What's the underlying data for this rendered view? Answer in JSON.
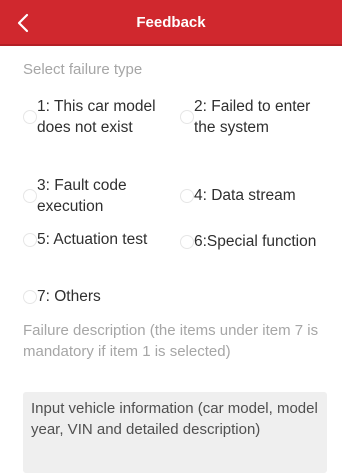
{
  "header": {
    "title": "Feedback"
  },
  "section": {
    "select_label": "Select failure type"
  },
  "options": [
    {
      "label": "1: This car model does not exist"
    },
    {
      "label": "2: Failed to enter the system"
    },
    {
      "label": "3: Fault code execution"
    },
    {
      "label": "4: Data stream"
    },
    {
      "label": "5: Actuation test"
    },
    {
      "label": "6:Special function"
    },
    {
      "label": "7: Others"
    }
  ],
  "description": {
    "label": "Failure description (the items under item 7 is mandatory if item 1 is selected)",
    "placeholder": "Input vehicle information (car model, model year, VIN and detailed description)"
  },
  "colors": {
    "header_bg": "#d0282e",
    "hint_text": "#a6a6a6",
    "body_text": "#2f2f2f"
  }
}
